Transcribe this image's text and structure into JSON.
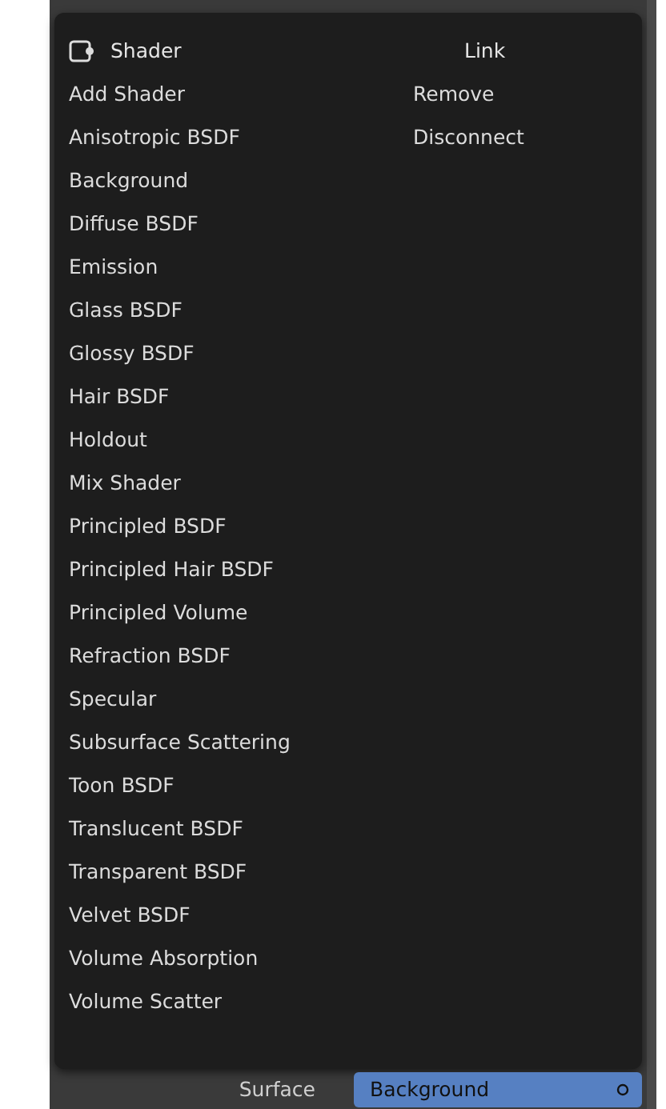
{
  "menu": {
    "shader_title": "Shader",
    "link_title": "Link",
    "link_items": [
      "Remove",
      "Disconnect"
    ],
    "items": [
      "Add Shader",
      "Anisotropic BSDF",
      "Background",
      "Diffuse BSDF",
      "Emission",
      "Glass BSDF",
      "Glossy BSDF",
      "Hair BSDF",
      "Holdout",
      "Mix Shader",
      "Principled BSDF",
      "Principled Hair BSDF",
      "Principled Volume",
      "Refraction BSDF",
      "Specular",
      "Subsurface Scattering",
      "Toon BSDF",
      "Translucent BSDF",
      "Transparent BSDF",
      "Velvet BSDF",
      "Volume Absorption",
      "Volume Scatter"
    ]
  },
  "property": {
    "label": "Surface",
    "value": "Background"
  }
}
